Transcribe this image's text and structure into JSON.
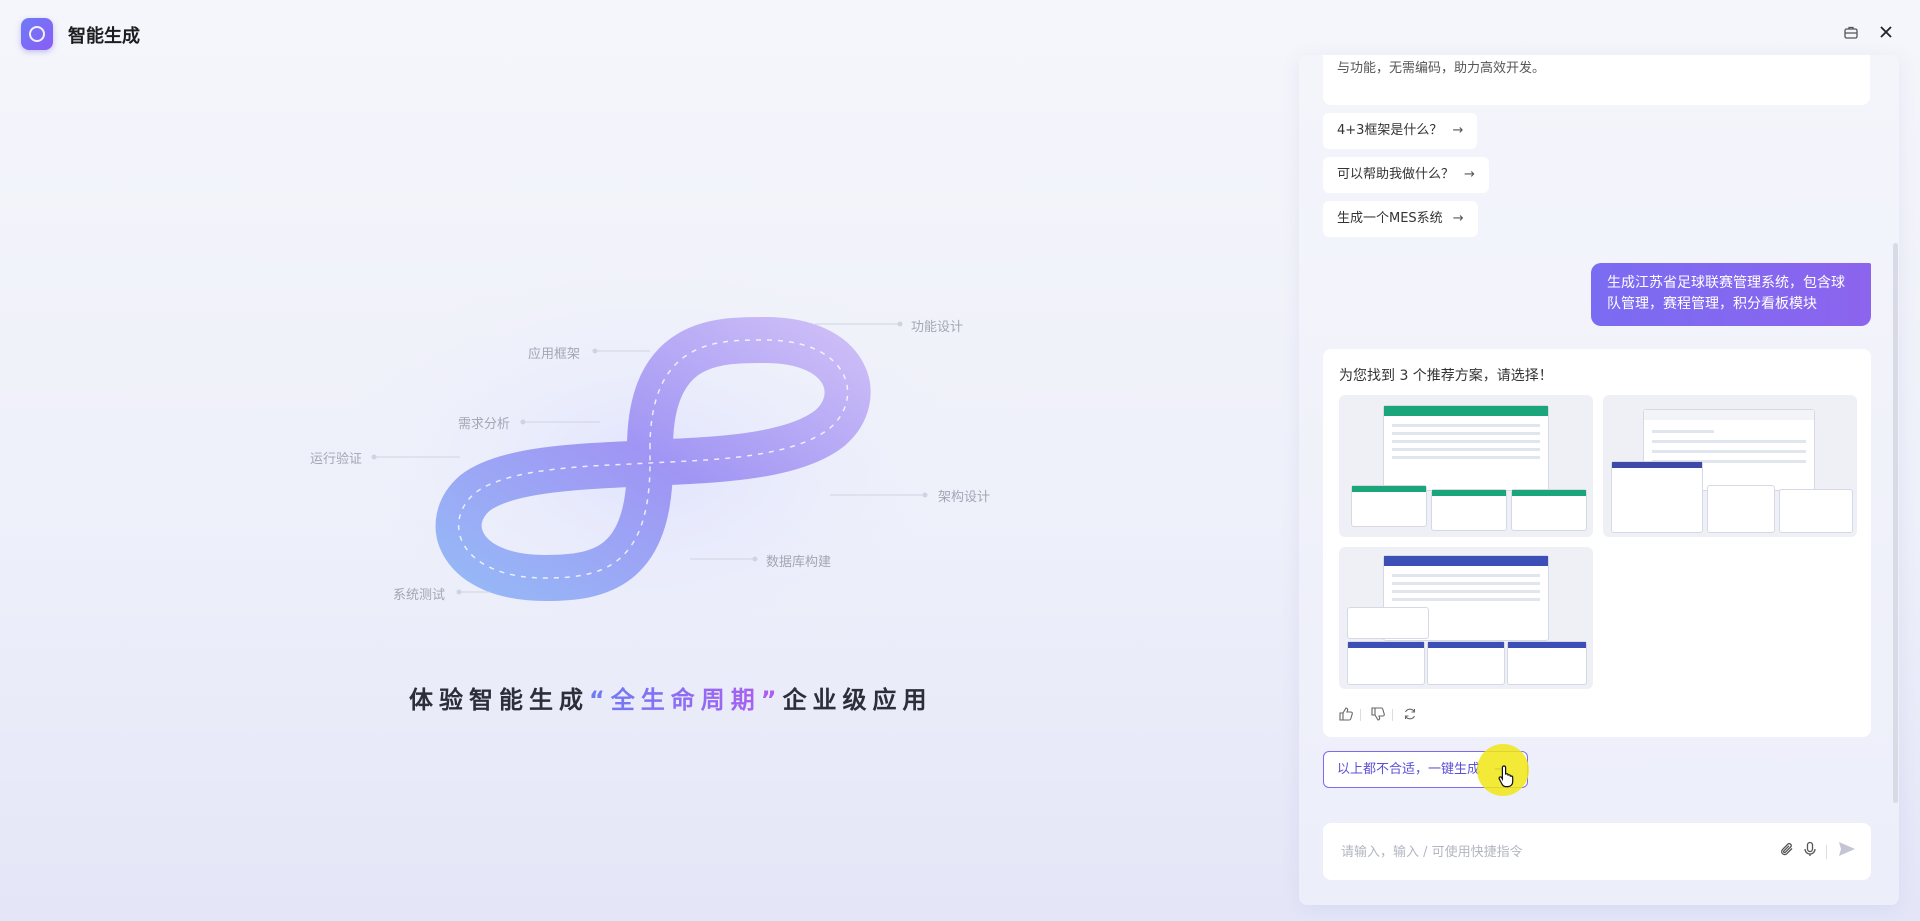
{
  "app": {
    "title": "智能生成"
  },
  "hero": {
    "stages": {
      "func_design": "功能设计",
      "app_framework": "应用框架",
      "req_analysis": "需求分析",
      "run_verify": "运行验证",
      "arch_design": "架构设计",
      "db_build": "数据库构建",
      "sys_test": "系统测试"
    },
    "slogan": {
      "prefix": "体验智能生成",
      "open_quote": "“",
      "highlight": "全生命周期",
      "close_quote": "”",
      "suffix": "企业级应用"
    }
  },
  "chat": {
    "intro_tail": "与功能，无需编码，助力高效开发。",
    "suggestions": [
      "4+3框架是什么？",
      "可以帮助我做什么？",
      "生成一个MES系统"
    ],
    "suggestion_arrow": "→",
    "user_message": "生成江苏省足球联赛管理系统，包含球队管理，赛程管理，积分看板模块",
    "answer_title": "为您找到 3 个推荐方案，请选择！",
    "regen_label": "以上都不合适，一键生成",
    "regen_arrow": "→",
    "input_placeholder": "请输入，输入 / 可使用快捷指令"
  }
}
